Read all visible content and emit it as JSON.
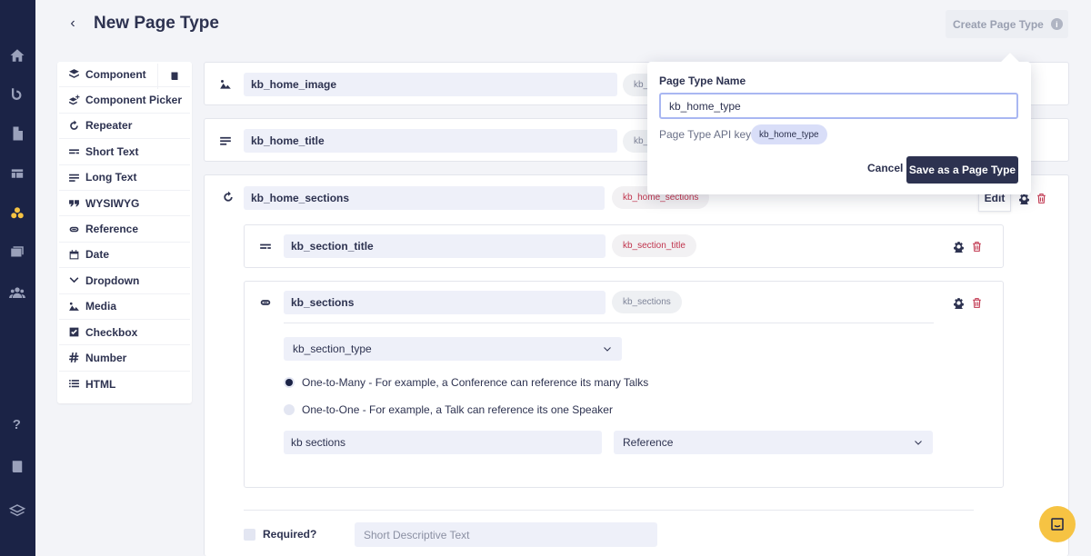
{
  "header": {
    "title": "New Page Type",
    "create_label": "Create Page Type"
  },
  "palette": {
    "items": [
      {
        "label": "Component",
        "icon": "layers-icon"
      },
      {
        "label": "Component Picker",
        "icon": "layers-plus-icon"
      },
      {
        "label": "Repeater",
        "icon": "repeat-icon"
      },
      {
        "label": "Short Text",
        "icon": "short-text-icon"
      },
      {
        "label": "Long Text",
        "icon": "long-text-icon"
      },
      {
        "label": "WYSIWYG",
        "icon": "quote-icon"
      },
      {
        "label": "Reference",
        "icon": "link-icon"
      },
      {
        "label": "Date",
        "icon": "calendar-icon"
      },
      {
        "label": "Dropdown",
        "icon": "chevron-down-icon"
      },
      {
        "label": "Media",
        "icon": "image-icon"
      },
      {
        "label": "Checkbox",
        "icon": "checkbox-icon"
      },
      {
        "label": "Number",
        "icon": "hash-icon"
      },
      {
        "label": "HTML",
        "icon": "list-icon"
      }
    ]
  },
  "fields": {
    "image": {
      "name": "kb_home_image",
      "key": "kb_"
    },
    "title": {
      "name": "kb_home_title",
      "key": "kb_"
    },
    "sections": {
      "name": "kb_home_sections",
      "key": "kb_home_sections",
      "edit_label": "Edit",
      "children": {
        "section_title": {
          "name": "kb_section_title",
          "key": "kb_section_title"
        },
        "sections": {
          "name": "kb_sections",
          "key": "kb_sections",
          "ref_type": "kb_section_type",
          "one_to_many": "One-to-Many - For example, a Conference can reference its many Talks",
          "one_to_one": "One-to-One - For example, a Talk can reference its one Speaker",
          "label_value": "kb sections",
          "kind_value": "Reference"
        }
      }
    }
  },
  "footer": {
    "required_label": "Required?",
    "desc_placeholder": "Short Descriptive Text"
  },
  "popover": {
    "name_label": "Page Type Name",
    "name_value": "kb_home_type",
    "api_label": "Page Type API key:",
    "api_value": "kb_home_type",
    "cancel_label": "Cancel",
    "save_label": "Save as a Page Type"
  },
  "colors": {
    "rail": "#1b2346",
    "accent": "#f6c343",
    "danger": "#c0344d",
    "primary": "#2d3250"
  }
}
